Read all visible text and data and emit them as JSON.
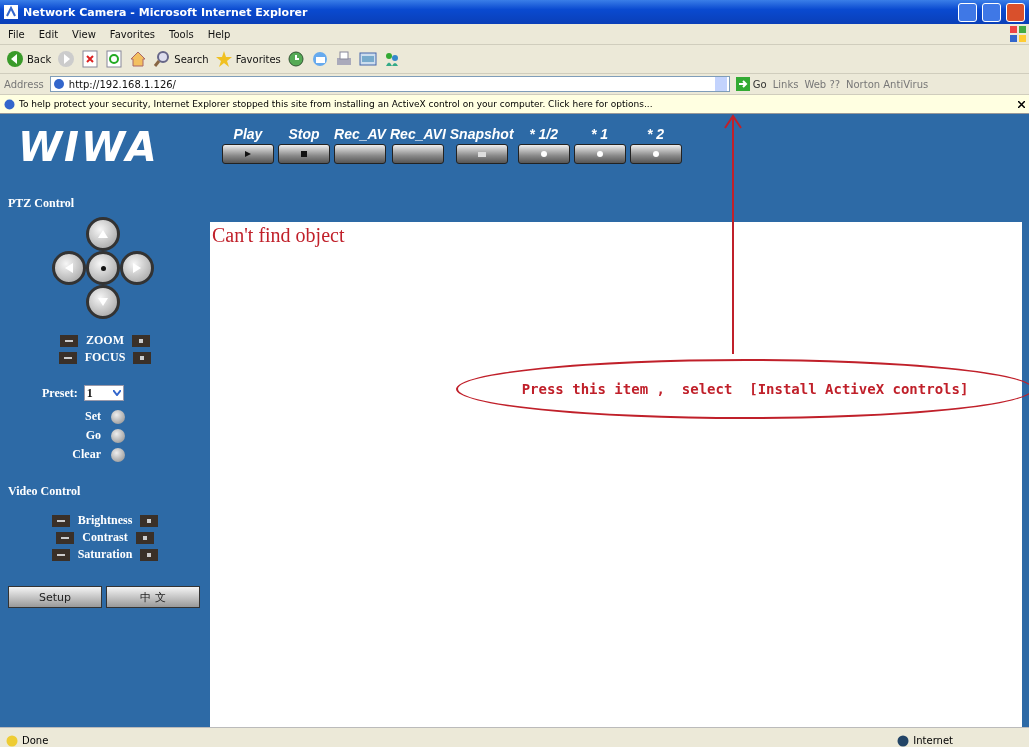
{
  "window": {
    "title": "Network Camera - Microsoft Internet Explorer"
  },
  "menu": [
    "File",
    "Edit",
    "View",
    "Favorites",
    "Tools",
    "Help"
  ],
  "toolbar": [
    {
      "kind": "back",
      "label": "Back"
    },
    {
      "kind": "forward"
    },
    {
      "kind": "stop"
    },
    {
      "kind": "refresh"
    },
    {
      "kind": "home"
    },
    {
      "kind": "search",
      "label": "Search"
    },
    {
      "kind": "favorites",
      "label": "Favorites"
    },
    {
      "kind": "history"
    },
    {
      "kind": "mail"
    },
    {
      "kind": "print"
    },
    {
      "kind": "edit"
    },
    {
      "kind": "messenger"
    }
  ],
  "address_bar": {
    "label": "Address",
    "value": "http://192.168.1.126/",
    "go": "Go",
    "links": "Links",
    "toolbar_items": [
      "Web ??",
      "Norton AntiVirus"
    ]
  },
  "info_bar": {
    "text": "To help protect your security, Internet Explorer stopped this site from installing an ActiveX control on your computer. Click here for options..."
  },
  "camera_page": {
    "logo": "WIWA",
    "video_buttons": [
      {
        "label": "Play",
        "kind": "play"
      },
      {
        "label": "Stop",
        "kind": "stop"
      },
      {
        "label": "Rec_AV",
        "kind": "blank"
      },
      {
        "label": "Rec_AVI",
        "kind": "blank"
      },
      {
        "label": "Snapshot",
        "kind": "snap"
      },
      {
        "label": "* 1/2",
        "kind": "dot"
      },
      {
        "label": "* 1",
        "kind": "dot"
      },
      {
        "label": "* 2",
        "kind": "dot"
      }
    ],
    "message": "Can't find object",
    "ptz": {
      "title": "PTZ Control",
      "adjust": [
        "ZOOM",
        "FOCUS"
      ]
    },
    "preset": {
      "label": "Preset:",
      "value": "1",
      "actions": [
        "Set",
        "Go",
        "Clear"
      ]
    },
    "video_control": {
      "title": "Video Control",
      "adjust": [
        "Brightness",
        "Contrast",
        "Saturation"
      ]
    },
    "buttons": [
      "Setup",
      "中  文"
    ]
  },
  "annotation": {
    "text": "Press this item ,  select  [Install ActiveX controls]"
  },
  "status_bar": {
    "text": "Done",
    "zone": "Internet"
  }
}
